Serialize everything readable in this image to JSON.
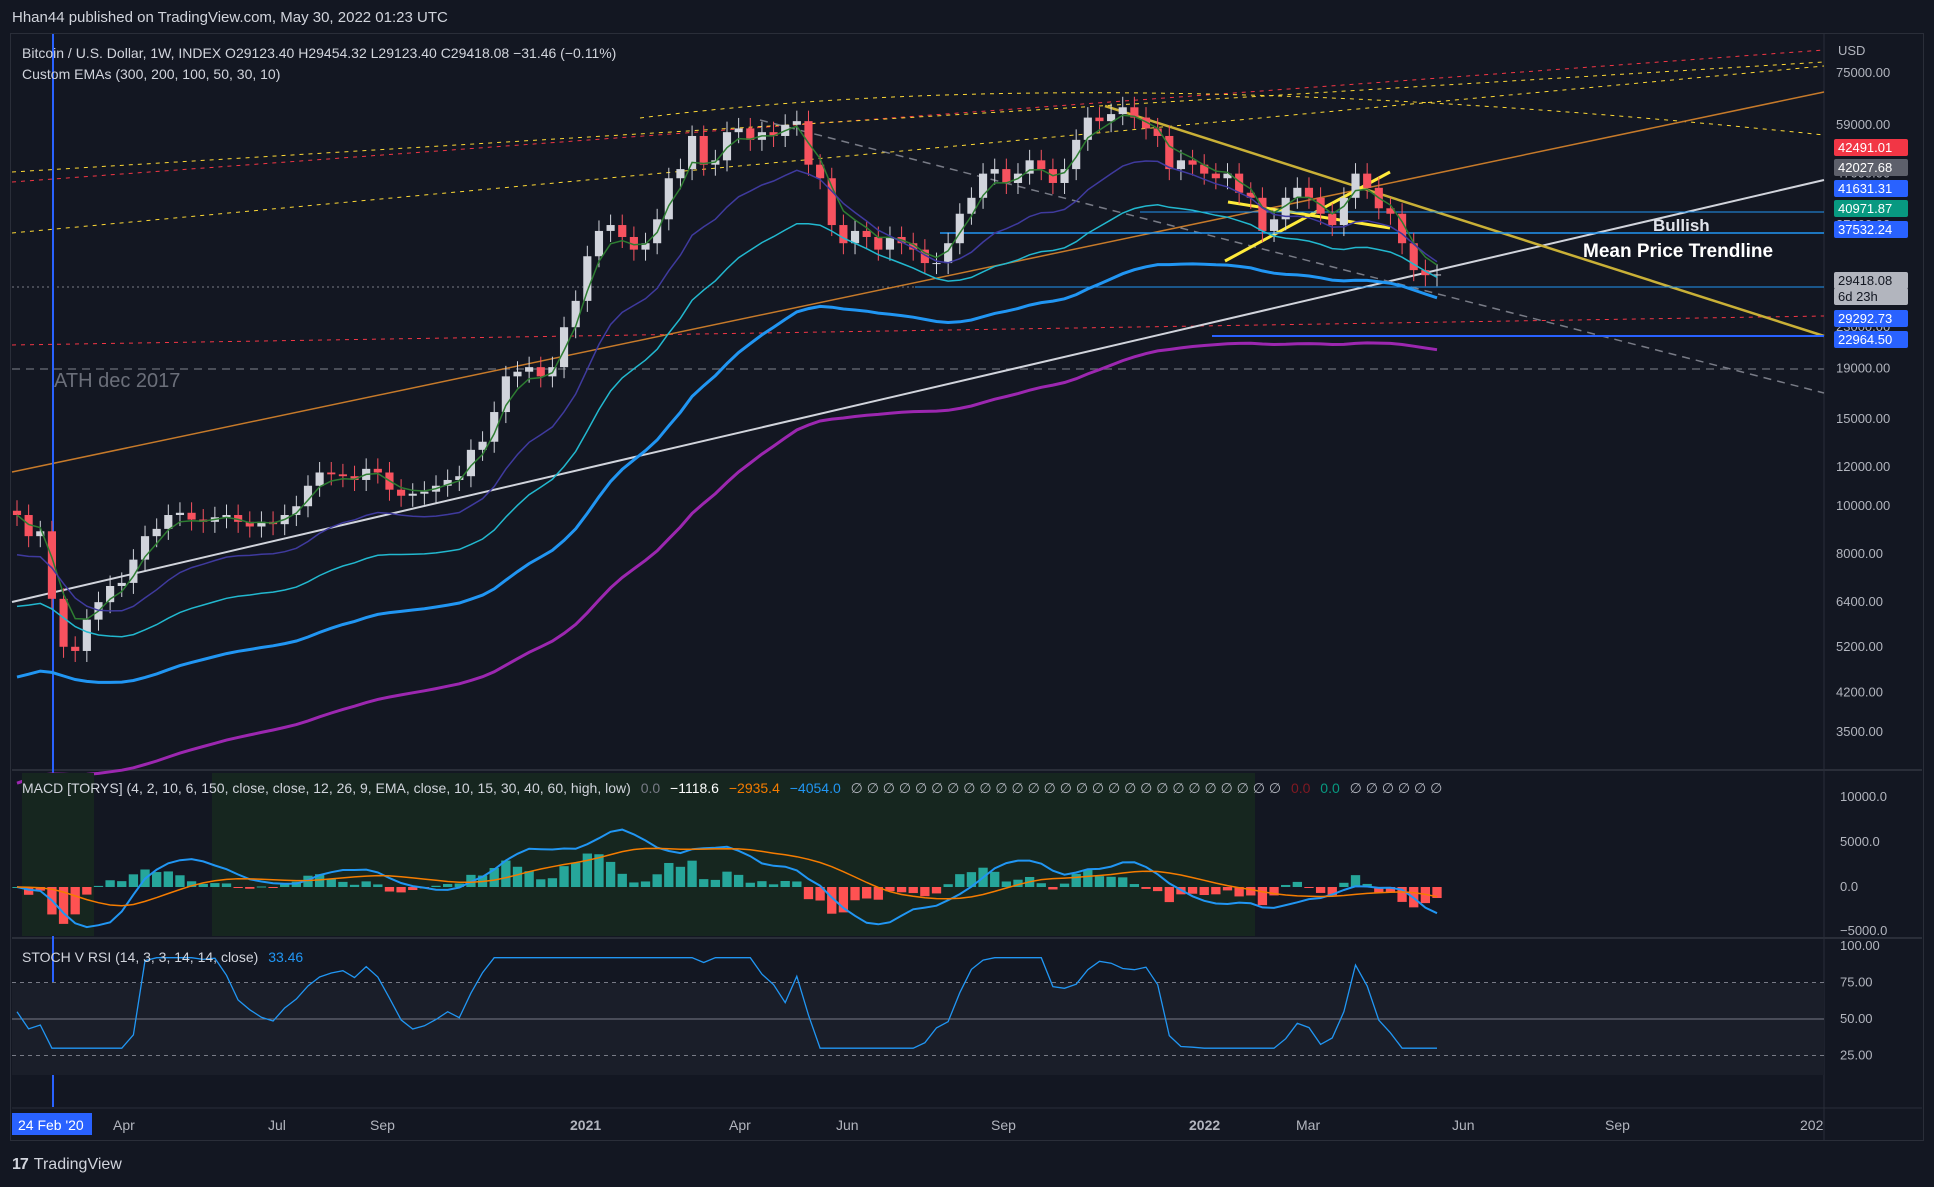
{
  "publisher": "Hhan44 published on TradingView.com, May 30, 2022 01:23 UTC",
  "legend": {
    "main": "Bitcoin / U.S. Dollar, 1W, INDEX  O29123.40  H29454.32  L29123.40  C29418.08  −31.46 (−0.11%)",
    "ema": "Custom EMAs (300, 200, 100, 50, 30, 10)",
    "macd_label": "MACD [TORYS] (4, 2, 10, 6, 150, close, close, 12, 26, 9, EMA, close, 10, 15, 30, 40, 60, high, low)",
    "macd_v0": "0.0",
    "macd_v1": "−1118.6",
    "macd_v2": "−2935.4",
    "macd_v3": "−4054.0",
    "macd_zeros": "∅ ∅ ∅ ∅ ∅ ∅ ∅ ∅ ∅ ∅ ∅ ∅ ∅ ∅ ∅ ∅ ∅ ∅ ∅ ∅ ∅ ∅ ∅ ∅ ∅ ∅ ∅",
    "macd_v4": "0.0",
    "macd_v5": "0.0",
    "macd_zeros2": "∅ ∅ ∅ ∅ ∅ ∅",
    "stoch_label": "STOCH V RSI (14, 3, 3, 14, 14, close)",
    "stoch_value": "33.46"
  },
  "annotations": {
    "bullish": "Bullish",
    "trendline": "Mean Price Trendline",
    "ath": "ATH dec 2017"
  },
  "footer": {
    "logo": "17",
    "brand": "TradingView"
  },
  "chart_data": {
    "type": "candlestick",
    "symbol": "Bitcoin / U.S. Dollar",
    "interval": "1W",
    "currency": "USD",
    "scale": "log",
    "ylim": [
      3000,
      90000
    ],
    "y_ticks": [
      75000,
      59000,
      47000,
      37000,
      29000,
      23000,
      19000,
      15000,
      12000,
      10000,
      8000,
      6400,
      5200,
      4200,
      3500
    ],
    "y_tick_labels": [
      "75000.00",
      "59000.00",
      "47000.00",
      "37000.00",
      "29000.00",
      "23000.00",
      "19000.00",
      "15000.00",
      "12000.00",
      "10000.00",
      "8000.00",
      "6400.00",
      "5200.00",
      "4200.00",
      "3500.00"
    ],
    "x_ticks": [
      "24 Feb '20",
      "Apr",
      "Jul",
      "Sep",
      "2021",
      "Apr",
      "Jun",
      "Sep",
      "2022",
      "Mar",
      "Jun",
      "Sep",
      "202"
    ],
    "price_labels": [
      {
        "value": "42491.01",
        "color": "#f23645"
      },
      {
        "value": "42027.68",
        "color": "#5d606b"
      },
      {
        "value": "41631.31",
        "color": "#2962ff"
      },
      {
        "value": "40971.87",
        "color": "#089981"
      },
      {
        "value": "37532.24",
        "color": "#2962ff"
      },
      {
        "value": "29418.08",
        "color": "#b2b5be"
      },
      {
        "value": "6d 23h",
        "color": "#b2b5be"
      },
      {
        "value": "29292.73",
        "color": "#2962ff"
      },
      {
        "value": "22964.50",
        "color": "#2962ff"
      }
    ],
    "close_series": [
      9600,
      8700,
      8900,
      6500,
      5200,
      5100,
      5900,
      6400,
      6900,
      7000,
      7800,
      8700,
      9000,
      9600,
      9700,
      9400,
      9300,
      9500,
      9600,
      9300,
      9100,
      9300,
      9200,
      9600,
      10000,
      11000,
      11700,
      11600,
      11500,
      11300,
      11900,
      11700,
      10800,
      10500,
      10600,
      10700,
      11000,
      11300,
      11500,
      13000,
      13500,
      15500,
      18300,
      18700,
      19100,
      18300,
      19100,
      23000,
      26000,
      32000,
      36000,
      37000,
      35000,
      33000,
      34000,
      38000,
      46000,
      48000,
      56000,
      49000,
      50000,
      57000,
      58000,
      55000,
      57000,
      56000,
      59000,
      60000,
      49000,
      46000,
      37000,
      34000,
      36000,
      35000,
      33000,
      35000,
      34000,
      33000,
      31000,
      31000,
      34000,
      39000,
      42000,
      47000,
      48000,
      45000,
      47000,
      50000,
      48000,
      45000,
      48000,
      55000,
      61000,
      60000,
      62000,
      64000,
      61000,
      58000,
      56000,
      48000,
      50000,
      49000,
      47000,
      46000,
      47000,
      43000,
      42000,
      36000,
      38000,
      42000,
      44000,
      42000,
      39000,
      37000,
      42000,
      47000,
      44000,
      40000,
      39000,
      34000,
      30000,
      29300,
      29400
    ],
    "series": [
      {
        "name": "EMA 10",
        "color": "#2e7d32"
      },
      {
        "name": "EMA 30",
        "color": "#3f3a9e"
      },
      {
        "name": "EMA 50",
        "color": "#22b8cf"
      },
      {
        "name": "EMA 100",
        "color": "#2196f3"
      },
      {
        "name": "EMA 200",
        "color": "#9c27b0"
      }
    ],
    "macd": {
      "ylim": [
        -5000,
        12000
      ],
      "ticks": [
        "10000.0",
        "5000.0",
        "0.0",
        "−5000.0"
      ]
    },
    "stoch_rsi": {
      "ylim": [
        0,
        100
      ],
      "ticks": [
        "100.00",
        "75.00",
        "50.00",
        "25.00"
      ]
    }
  }
}
